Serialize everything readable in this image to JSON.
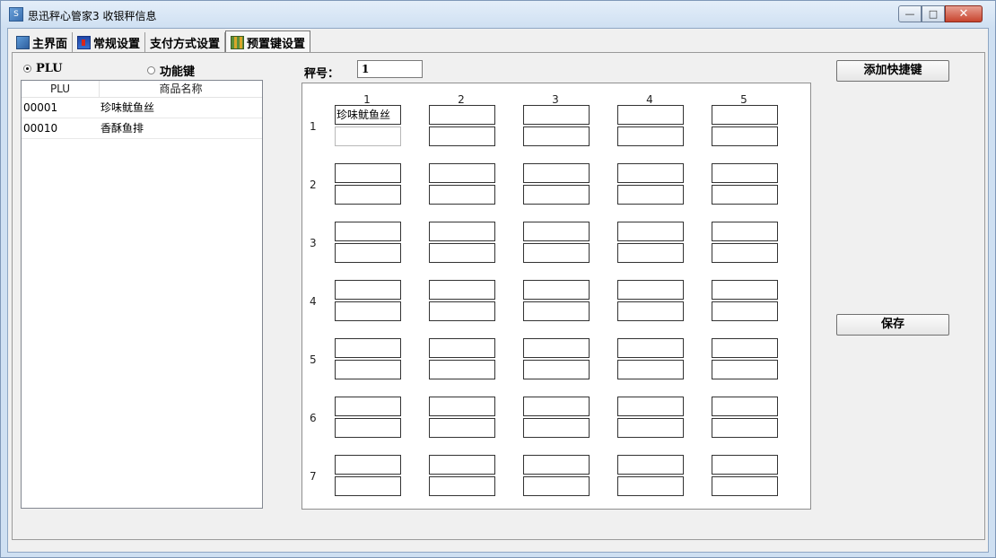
{
  "window": {
    "title": "思迅秤心管家3  收银秤信息"
  },
  "tabs": [
    {
      "label": "主界面",
      "icon": "home-icon"
    },
    {
      "label": "常规设置",
      "icon": "settings-icon"
    },
    {
      "label": "支付方式设置",
      "icon": ""
    },
    {
      "label": "预置键设置",
      "icon": "keys-icon"
    }
  ],
  "mode": {
    "plu_label": "PLU",
    "func_label": "功能键",
    "selected": "PLU"
  },
  "plu_list": {
    "headers": {
      "plu": "PLU",
      "name": "商品名称"
    },
    "rows": [
      {
        "plu": "00001",
        "name": "珍味鱿鱼丝"
      },
      {
        "plu": "00010",
        "name": "香酥鱼排"
      }
    ]
  },
  "scale": {
    "label": "秤号：",
    "value": "1"
  },
  "grid": {
    "columns": [
      "1",
      "2",
      "3",
      "4",
      "5"
    ],
    "rows": [
      "1",
      "2",
      "3",
      "4",
      "5",
      "6",
      "7"
    ],
    "cell_1_1_top": "珍味鱿鱼丝"
  },
  "buttons": {
    "add_shortcut": "添加快捷键",
    "save": "保存"
  }
}
